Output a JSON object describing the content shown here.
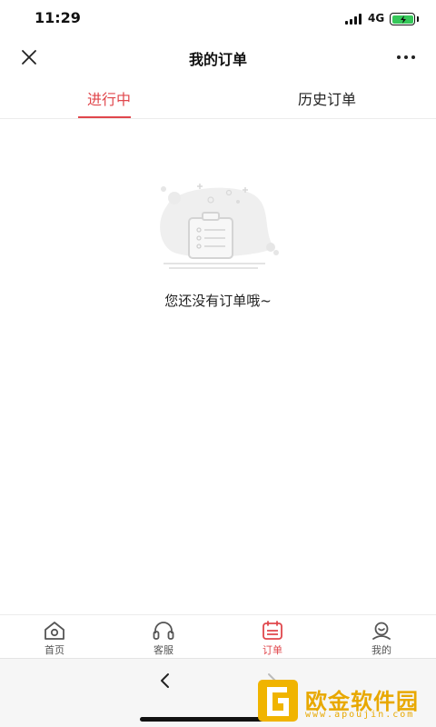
{
  "status_bar": {
    "time": "11:29",
    "network": "4G",
    "battery_level": 1.0,
    "battery_color": "#35c759"
  },
  "header": {
    "title": "我的订单",
    "close_icon": "close-icon",
    "more_icon": "more-icon"
  },
  "tabs": [
    {
      "label": "进行中",
      "active": true
    },
    {
      "label": "历史订单",
      "active": false
    }
  ],
  "empty_state": {
    "message": "您还没有订单哦~",
    "icon": "clipboard-icon"
  },
  "tabbar": [
    {
      "label": "首页",
      "icon": "home-icon",
      "active": false
    },
    {
      "label": "客服",
      "icon": "headset-icon",
      "active": false
    },
    {
      "label": "订单",
      "icon": "order-icon",
      "active": true
    },
    {
      "label": "我的",
      "icon": "user-icon",
      "active": false
    }
  ],
  "browser": {
    "back_icon": "chevron-left-icon",
    "forward_icon": "chevron-right-icon"
  },
  "watermark": {
    "brand": "欧金软件园",
    "url": "www.apoujin.com"
  },
  "colors": {
    "accent": "#e0474c",
    "watermark": "#e8a800"
  }
}
